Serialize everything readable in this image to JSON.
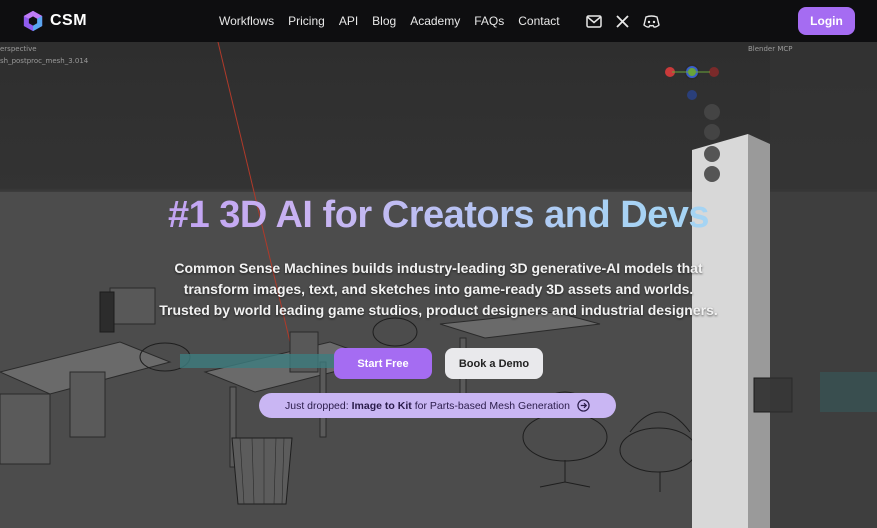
{
  "brand": {
    "name": "CSM"
  },
  "nav": {
    "links": [
      "Workflows",
      "Pricing",
      "API",
      "Blog",
      "Academy",
      "FAQs",
      "Contact"
    ],
    "icons": [
      "mail-icon",
      "x-icon",
      "discord-icon"
    ],
    "login_label": "Login"
  },
  "viewport": {
    "mode_label": "erspective",
    "object_label": "sh_postproc_mesh_3.014",
    "outliner_label": "Blender MCP",
    "gizmo_axes": [
      "Z",
      "Y",
      "X"
    ]
  },
  "hero": {
    "title": "#1 3D AI for Creators and Devs",
    "subtitle_lines": [
      "Common Sense Machines builds industry-leading 3D generative-AI models  that",
      "transform  images, text, and sketches into game-ready 3D assets and worlds.",
      "Trusted by world leading game studios, product designers and industrial designers."
    ],
    "primary_cta": "Start Free",
    "secondary_cta": "Book a Demo",
    "announcement": {
      "prefix": "Just dropped:",
      "highlight": "Image to Kit",
      "suffix": "for Parts-based Mesh Generation"
    }
  },
  "colors": {
    "accent": "#a56cf2",
    "nav_bg": "#0e0e10",
    "title_gradient_start": "#b990f5",
    "title_gradient_end": "#9fd7f2",
    "announcement_bg": "#c9b6f3"
  }
}
